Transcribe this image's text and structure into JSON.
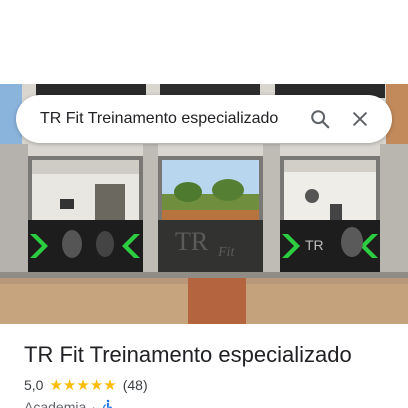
{
  "search": {
    "query": "TR Fit Treinamento especializado"
  },
  "hero": {
    "logo_text": "TR",
    "logo_script": "Fit"
  },
  "place": {
    "title": "TR Fit Treinamento especializado",
    "rating": "5,0",
    "stars": 5,
    "review_count": "(48)",
    "category": "Academia",
    "separator": "·"
  },
  "colors": {
    "star": "#fbbc04",
    "accent_green": "#2ecc40",
    "accessibility_blue": "#1a73e8"
  },
  "icons": {
    "search": "search-icon",
    "close": "close-icon",
    "accessibility": "wheelchair-icon"
  }
}
